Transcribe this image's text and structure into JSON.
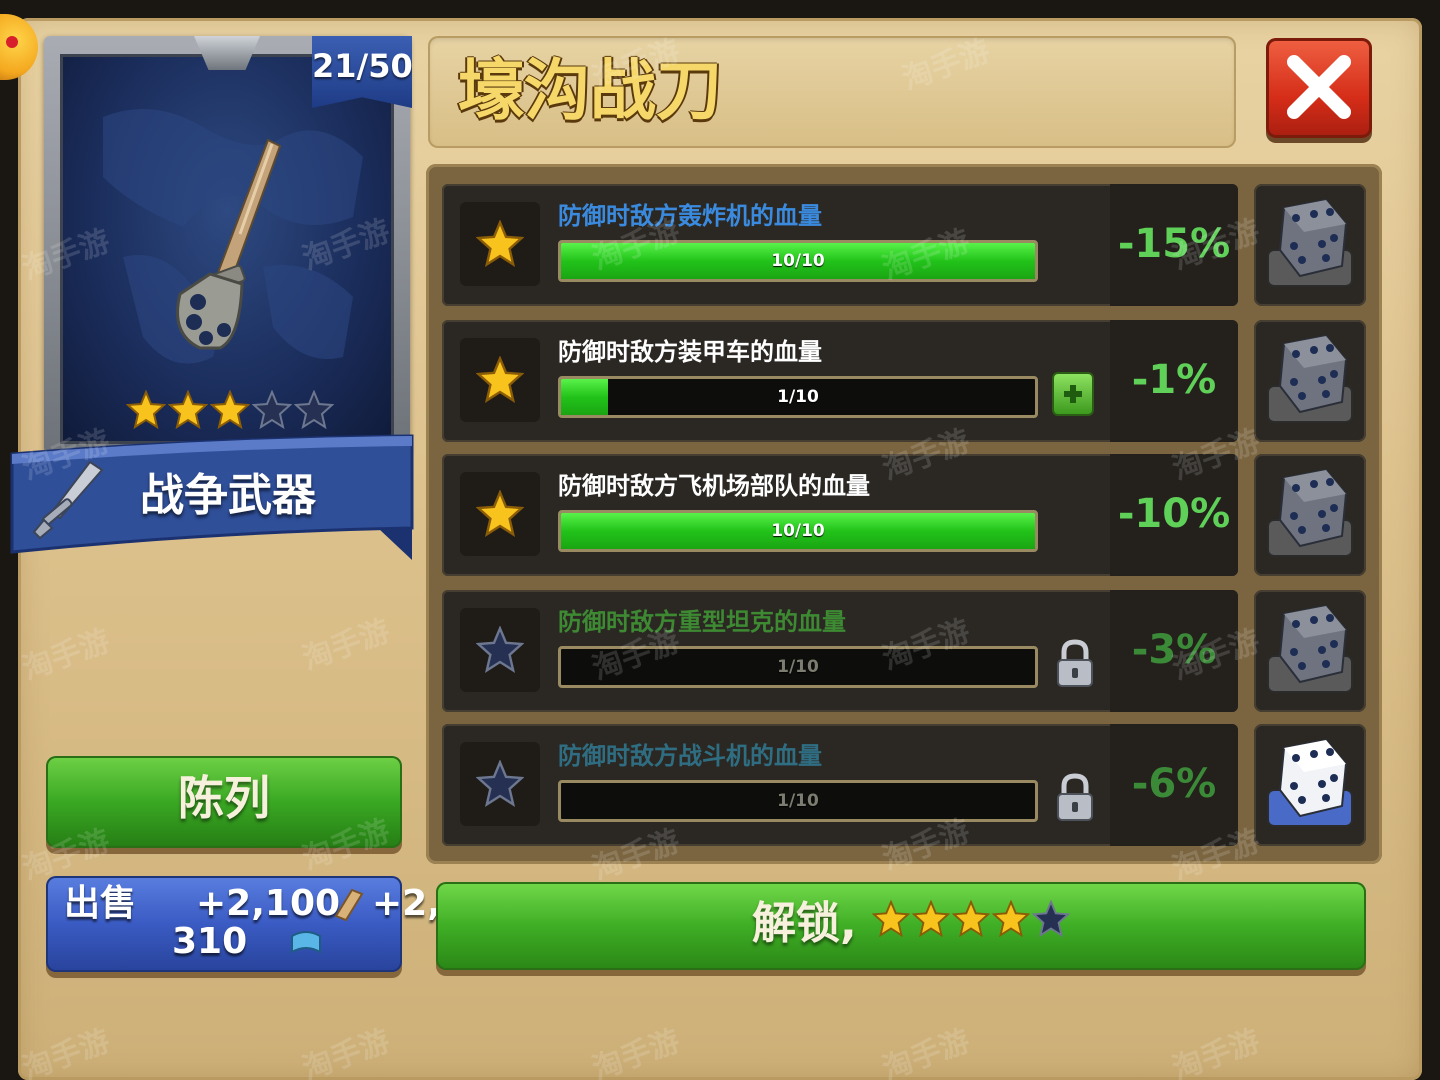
{
  "item": {
    "name": "壕沟战刀",
    "count": "21/50",
    "category": "战争武器",
    "card_stars": {
      "filled": 3,
      "total": 5
    },
    "icon": "knife-icon"
  },
  "stats": [
    {
      "label": "防御时敌方轰炸机的血量",
      "progress": "10/10",
      "fill": 1.0,
      "percent": "-15%",
      "state": "maxed",
      "label_color": "#3a8be0"
    },
    {
      "label": "防御时敌方装甲车的血量",
      "progress": "1/10",
      "fill": 0.1,
      "percent": "-1%",
      "state": "upgradable",
      "label_color": "#ffffff"
    },
    {
      "label": "防御时敌方飞机场部队的血量",
      "progress": "10/10",
      "fill": 1.0,
      "percent": "-10%",
      "state": "maxed",
      "label_color": "#ffffff"
    },
    {
      "label": "防御时敌方重型坦克的血量",
      "progress": "1/10",
      "fill": 0.0,
      "percent": "-3%",
      "state": "locked",
      "label_color": "#3d8a33"
    },
    {
      "label": "防御时敌方战斗机的血量",
      "progress": "1/10",
      "fill": 0.0,
      "percent": "-6%",
      "state": "locked",
      "label_color": "#2f6e82"
    }
  ],
  "buttons": {
    "display": "陈列",
    "sell_label": "出售",
    "sell_amount_wood": "+2,100",
    "sell_amount_scroll_a": "+2,",
    "sell_amount_scroll_b": "310",
    "unlock_label": "解锁,",
    "unlock_stars": {
      "filled": 4,
      "total": 5
    },
    "close": "close-icon"
  },
  "colors": {
    "frame": "#dcc08b",
    "green_text": "#5fd158",
    "title": "#f6d86a",
    "close_red": "#d52d18"
  },
  "watermark": "淘手游"
}
